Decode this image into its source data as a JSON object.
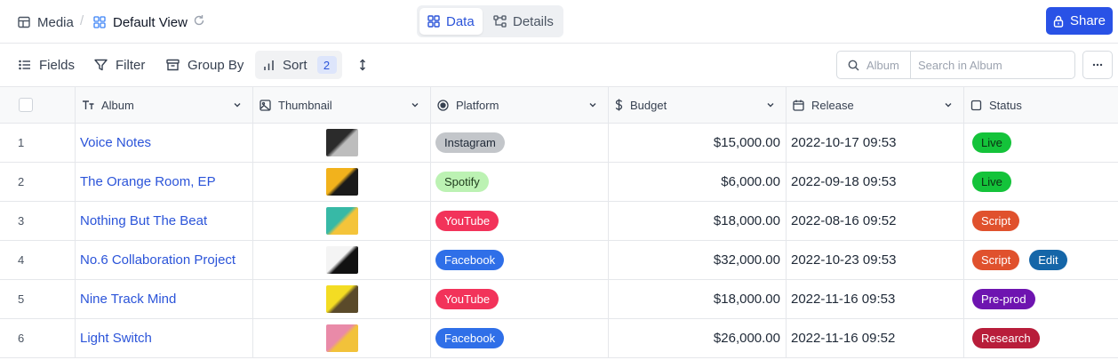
{
  "breadcrumb": {
    "workspace": "Media",
    "separator": "/",
    "view": "Default View"
  },
  "view_switch": {
    "data_label": "Data",
    "details_label": "Details",
    "active": "Data"
  },
  "share_label": "Share",
  "toolbar": {
    "fields_label": "Fields",
    "filter_label": "Filter",
    "group_label": "Group By",
    "sort_label": "Sort",
    "sort_count": "2",
    "search_scope": "Album",
    "search_placeholder": "Search in Album"
  },
  "columns": [
    {
      "label": "Album",
      "icon": "text-type-icon"
    },
    {
      "label": "Thumbnail",
      "icon": "image-icon"
    },
    {
      "label": "Platform",
      "icon": "single-select-icon"
    },
    {
      "label": "Budget",
      "icon": "currency-icon"
    },
    {
      "label": "Release",
      "icon": "calendar-icon"
    },
    {
      "label": "Status",
      "icon": "multi-select-icon"
    }
  ],
  "rows": [
    {
      "num": "1",
      "album": "Voice Notes",
      "thumb_colors": [
        "#2b2b2b",
        "#bdbdbd"
      ],
      "platform": {
        "label": "Instagram",
        "bg": "#c3c6ca",
        "fg": "#1f2937"
      },
      "budget": "$15,000.00",
      "release": "2022-10-17 09:53",
      "status": [
        {
          "label": "Live",
          "bg": "#14c33a",
          "fg": "#0b2e12"
        }
      ]
    },
    {
      "num": "2",
      "album": "The Orange Room, EP",
      "thumb_colors": [
        "#f2b21c",
        "#1a1a1a"
      ],
      "platform": {
        "label": "Spotify",
        "bg": "#bcf2b3",
        "fg": "#1f3b1c"
      },
      "budget": "$6,000.00",
      "release": "2022-09-18 09:53",
      "status": [
        {
          "label": "Live",
          "bg": "#14c33a",
          "fg": "#0b2e12"
        }
      ]
    },
    {
      "num": "3",
      "album": "Nothing But The Beat",
      "thumb_colors": [
        "#37b9a6",
        "#f4c43a"
      ],
      "platform": {
        "label": "YouTube",
        "bg": "#f2335a",
        "fg": "#ffffff"
      },
      "budget": "$18,000.00",
      "release": "2022-08-16 09:52",
      "status": [
        {
          "label": "Script",
          "bg": "#e0512d",
          "fg": "#ffffff"
        }
      ]
    },
    {
      "num": "4",
      "album": "No.6 Collaboration Project",
      "thumb_colors": [
        "#f4f4f4",
        "#111111"
      ],
      "platform": {
        "label": "Facebook",
        "bg": "#2f6fe8",
        "fg": "#ffffff"
      },
      "budget": "$32,000.00",
      "release": "2022-10-23 09:53",
      "status": [
        {
          "label": "Script",
          "bg": "#e0512d",
          "fg": "#ffffff"
        },
        {
          "label": "Edit",
          "bg": "#1566a8",
          "fg": "#ffffff"
        }
      ]
    },
    {
      "num": "5",
      "album": "Nine Track Mind",
      "thumb_colors": [
        "#f3dc23",
        "#5a4a2a"
      ],
      "platform": {
        "label": "YouTube",
        "bg": "#f2335a",
        "fg": "#ffffff"
      },
      "budget": "$18,000.00",
      "release": "2022-11-16 09:53",
      "status": [
        {
          "label": "Pre-prod",
          "bg": "#6e14b0",
          "fg": "#ffffff"
        }
      ]
    },
    {
      "num": "6",
      "album": "Light Switch",
      "thumb_colors": [
        "#e98aa8",
        "#f2c23a"
      ],
      "platform": {
        "label": "Facebook",
        "bg": "#2f6fe8",
        "fg": "#ffffff"
      },
      "budget": "$26,000.00",
      "release": "2022-11-16 09:52",
      "status": [
        {
          "label": "Research",
          "bg": "#b81d3a",
          "fg": "#ffffff"
        }
      ]
    }
  ],
  "colors": {
    "accent": "#2952e6",
    "link": "#2b54d9",
    "border": "#e5e7eb"
  }
}
